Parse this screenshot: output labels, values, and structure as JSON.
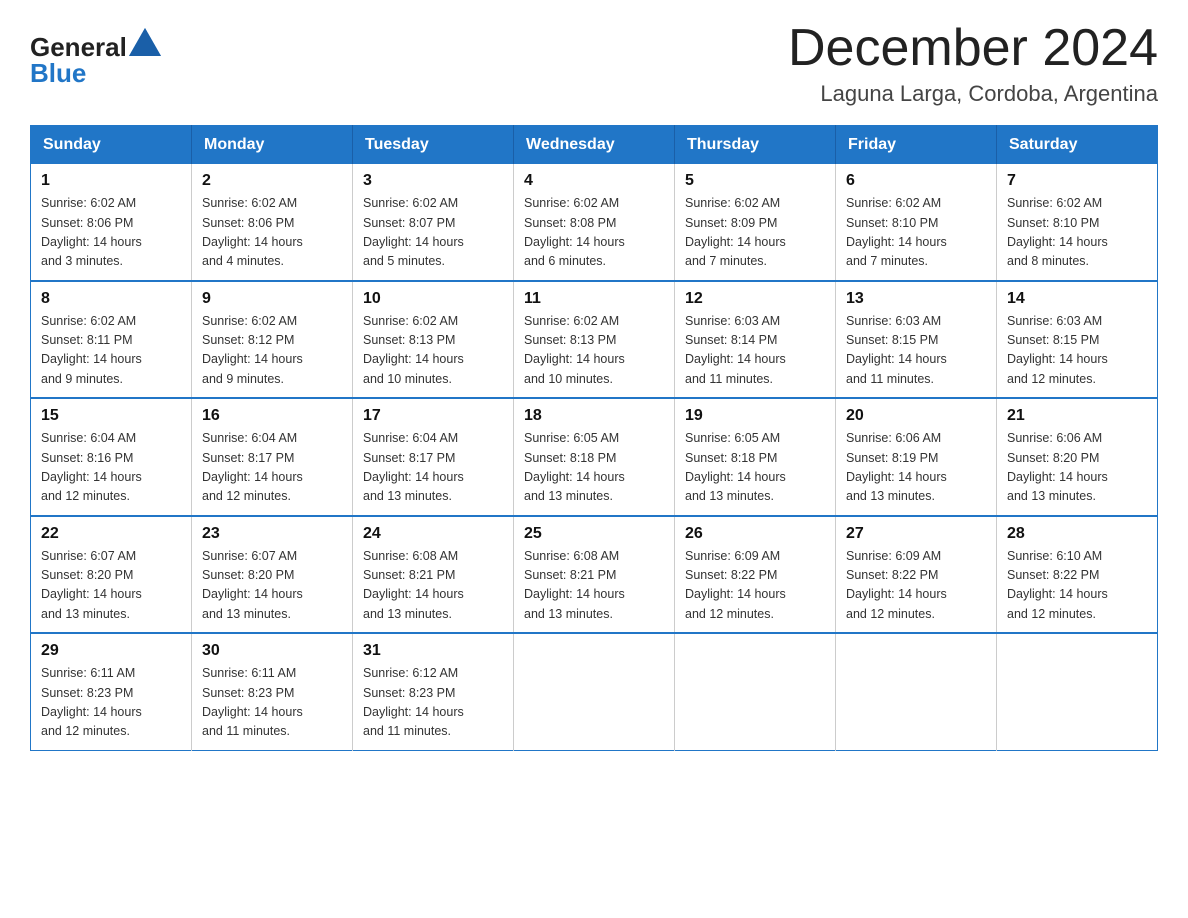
{
  "header": {
    "logo_general": "General",
    "logo_blue": "Blue",
    "main_title": "December 2024",
    "subtitle": "Laguna Larga, Cordoba, Argentina"
  },
  "days_of_week": [
    "Sunday",
    "Monday",
    "Tuesday",
    "Wednesday",
    "Thursday",
    "Friday",
    "Saturday"
  ],
  "weeks": [
    [
      {
        "day": "1",
        "sunrise": "6:02 AM",
        "sunset": "8:06 PM",
        "daylight_hours": "14",
        "daylight_minutes": "3"
      },
      {
        "day": "2",
        "sunrise": "6:02 AM",
        "sunset": "8:06 PM",
        "daylight_hours": "14",
        "daylight_minutes": "4"
      },
      {
        "day": "3",
        "sunrise": "6:02 AM",
        "sunset": "8:07 PM",
        "daylight_hours": "14",
        "daylight_minutes": "5"
      },
      {
        "day": "4",
        "sunrise": "6:02 AM",
        "sunset": "8:08 PM",
        "daylight_hours": "14",
        "daylight_minutes": "6"
      },
      {
        "day": "5",
        "sunrise": "6:02 AM",
        "sunset": "8:09 PM",
        "daylight_hours": "14",
        "daylight_minutes": "7"
      },
      {
        "day": "6",
        "sunrise": "6:02 AM",
        "sunset": "8:10 PM",
        "daylight_hours": "14",
        "daylight_minutes": "7"
      },
      {
        "day": "7",
        "sunrise": "6:02 AM",
        "sunset": "8:10 PM",
        "daylight_hours": "14",
        "daylight_minutes": "8"
      }
    ],
    [
      {
        "day": "8",
        "sunrise": "6:02 AM",
        "sunset": "8:11 PM",
        "daylight_hours": "14",
        "daylight_minutes": "9"
      },
      {
        "day": "9",
        "sunrise": "6:02 AM",
        "sunset": "8:12 PM",
        "daylight_hours": "14",
        "daylight_minutes": "9"
      },
      {
        "day": "10",
        "sunrise": "6:02 AM",
        "sunset": "8:13 PM",
        "daylight_hours": "14",
        "daylight_minutes": "10"
      },
      {
        "day": "11",
        "sunrise": "6:02 AM",
        "sunset": "8:13 PM",
        "daylight_hours": "14",
        "daylight_minutes": "10"
      },
      {
        "day": "12",
        "sunrise": "6:03 AM",
        "sunset": "8:14 PM",
        "daylight_hours": "14",
        "daylight_minutes": "11"
      },
      {
        "day": "13",
        "sunrise": "6:03 AM",
        "sunset": "8:15 PM",
        "daylight_hours": "14",
        "daylight_minutes": "11"
      },
      {
        "day": "14",
        "sunrise": "6:03 AM",
        "sunset": "8:15 PM",
        "daylight_hours": "14",
        "daylight_minutes": "12"
      }
    ],
    [
      {
        "day": "15",
        "sunrise": "6:04 AM",
        "sunset": "8:16 PM",
        "daylight_hours": "14",
        "daylight_minutes": "12"
      },
      {
        "day": "16",
        "sunrise": "6:04 AM",
        "sunset": "8:17 PM",
        "daylight_hours": "14",
        "daylight_minutes": "12"
      },
      {
        "day": "17",
        "sunrise": "6:04 AM",
        "sunset": "8:17 PM",
        "daylight_hours": "14",
        "daylight_minutes": "13"
      },
      {
        "day": "18",
        "sunrise": "6:05 AM",
        "sunset": "8:18 PM",
        "daylight_hours": "14",
        "daylight_minutes": "13"
      },
      {
        "day": "19",
        "sunrise": "6:05 AM",
        "sunset": "8:18 PM",
        "daylight_hours": "14",
        "daylight_minutes": "13"
      },
      {
        "day": "20",
        "sunrise": "6:06 AM",
        "sunset": "8:19 PM",
        "daylight_hours": "14",
        "daylight_minutes": "13"
      },
      {
        "day": "21",
        "sunrise": "6:06 AM",
        "sunset": "8:20 PM",
        "daylight_hours": "14",
        "daylight_minutes": "13"
      }
    ],
    [
      {
        "day": "22",
        "sunrise": "6:07 AM",
        "sunset": "8:20 PM",
        "daylight_hours": "14",
        "daylight_minutes": "13"
      },
      {
        "day": "23",
        "sunrise": "6:07 AM",
        "sunset": "8:20 PM",
        "daylight_hours": "14",
        "daylight_minutes": "13"
      },
      {
        "day": "24",
        "sunrise": "6:08 AM",
        "sunset": "8:21 PM",
        "daylight_hours": "14",
        "daylight_minutes": "13"
      },
      {
        "day": "25",
        "sunrise": "6:08 AM",
        "sunset": "8:21 PM",
        "daylight_hours": "14",
        "daylight_minutes": "13"
      },
      {
        "day": "26",
        "sunrise": "6:09 AM",
        "sunset": "8:22 PM",
        "daylight_hours": "14",
        "daylight_minutes": "12"
      },
      {
        "day": "27",
        "sunrise": "6:09 AM",
        "sunset": "8:22 PM",
        "daylight_hours": "14",
        "daylight_minutes": "12"
      },
      {
        "day": "28",
        "sunrise": "6:10 AM",
        "sunset": "8:22 PM",
        "daylight_hours": "14",
        "daylight_minutes": "12"
      }
    ],
    [
      {
        "day": "29",
        "sunrise": "6:11 AM",
        "sunset": "8:23 PM",
        "daylight_hours": "14",
        "daylight_minutes": "12"
      },
      {
        "day": "30",
        "sunrise": "6:11 AM",
        "sunset": "8:23 PM",
        "daylight_hours": "14",
        "daylight_minutes": "11"
      },
      {
        "day": "31",
        "sunrise": "6:12 AM",
        "sunset": "8:23 PM",
        "daylight_hours": "14",
        "daylight_minutes": "11"
      },
      null,
      null,
      null,
      null
    ]
  ]
}
